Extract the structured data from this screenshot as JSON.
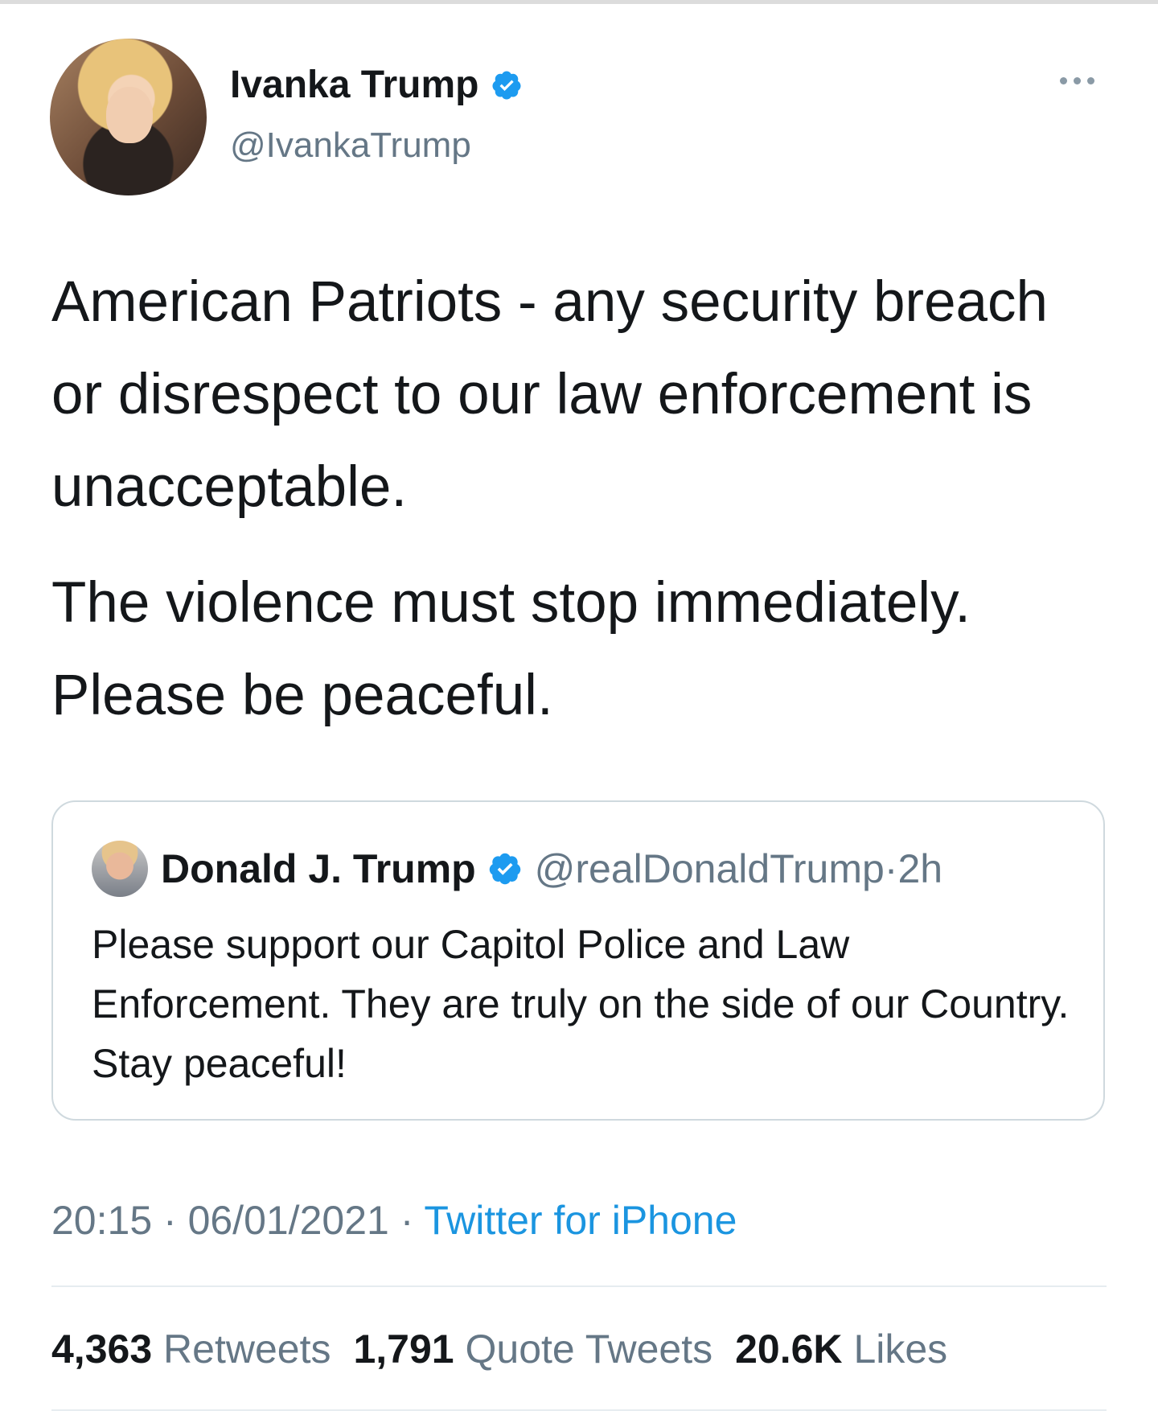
{
  "tweet": {
    "author": {
      "name": "Ivanka Trump",
      "handle": "@IvankaTrump",
      "verified": true
    },
    "paragraphs": [
      "American Patriots - any security breach or disrespect to our law enforcement is unacceptable.",
      "The violence must stop immediately. Please be peaceful."
    ],
    "quoted": {
      "name": "Donald J. Trump",
      "handle": "@realDonaldTrump",
      "separator": "·",
      "time": "2h",
      "text": "Please support our Capitol Police and Law Enforcement. They are truly on the side of our Country. Stay peaceful!"
    },
    "meta": {
      "time": "20:15",
      "separator": " · ",
      "date": "06/01/2021",
      "source": "Twitter for iPhone"
    },
    "stats": {
      "retweets_count": "4,363",
      "retweets_label": "Retweets",
      "quotes_count": "1,791",
      "quotes_label": "Quote Tweets",
      "likes_count": "20.6K",
      "likes_label": "Likes"
    }
  },
  "icons": {
    "verified": "verified-badge-icon",
    "more": "more-dots-icon"
  },
  "colors": {
    "verified_blue": "#1d9bf0",
    "link_blue": "#1b95e0",
    "muted_text": "#657786",
    "border": "#cfd9de"
  }
}
